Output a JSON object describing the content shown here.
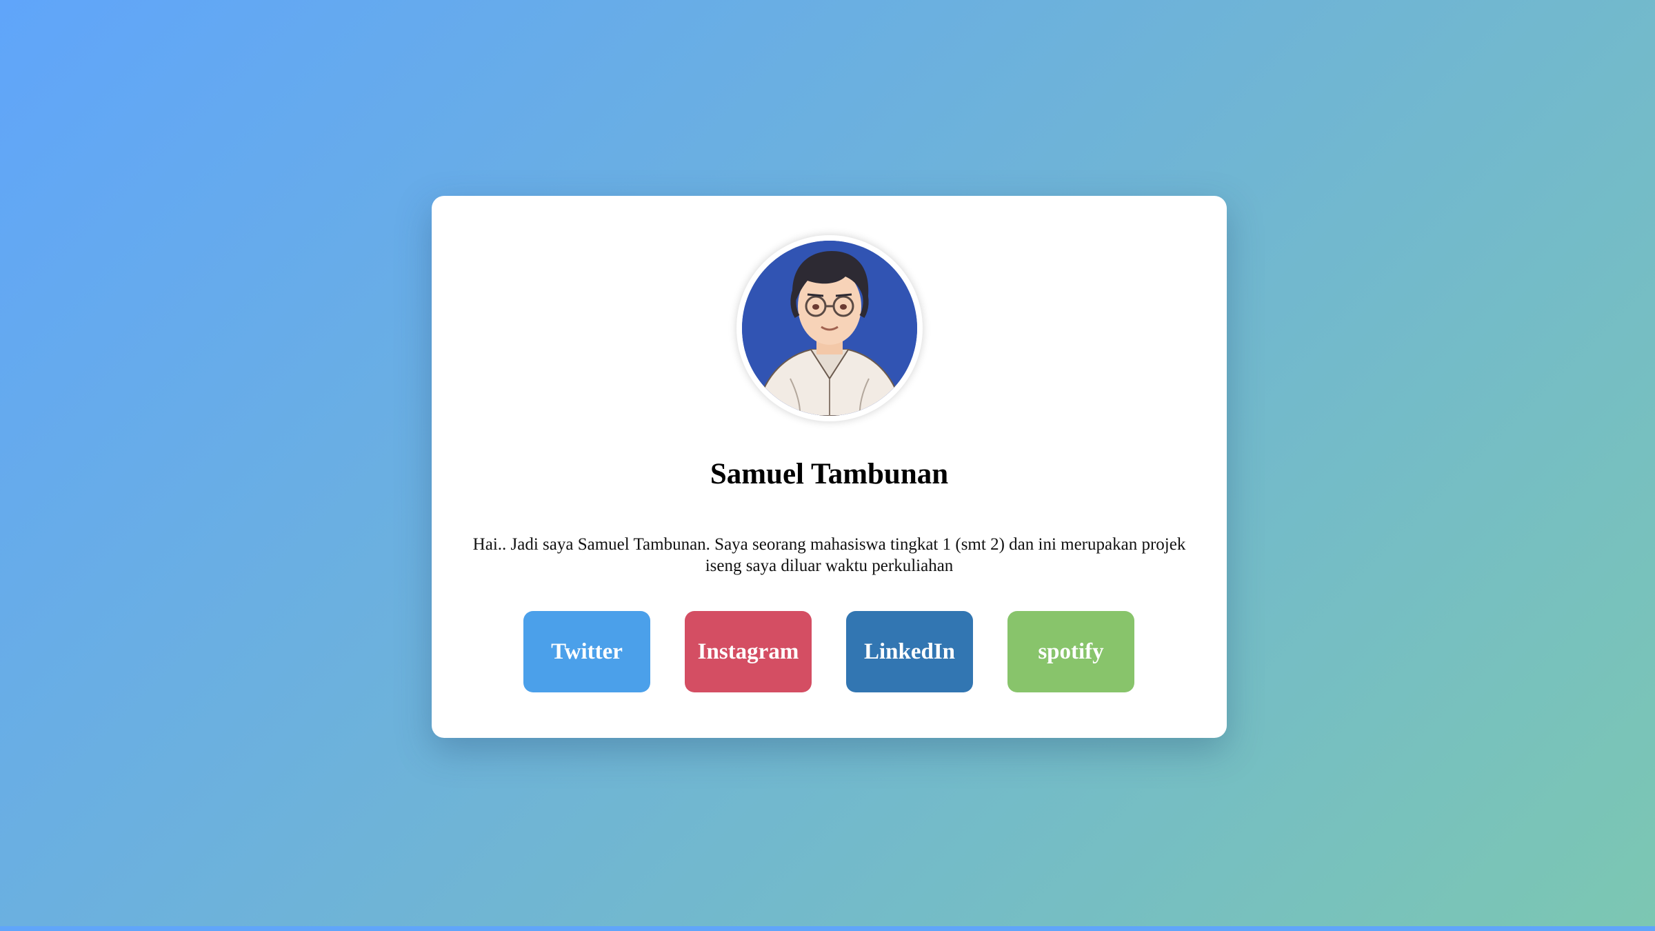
{
  "profile": {
    "name": "Samuel Tambunan",
    "bio": "Hai.. Jadi saya Samuel Tambunan. Saya seorang mahasiswa tingkat 1 (smt 2) dan ini merupakan projek iseng saya diluar waktu perkuliahan",
    "avatar_icon": "avatar-illustration"
  },
  "links": {
    "twitter": "Twitter",
    "instagram": "Instagram",
    "linkedin": "LinkedIn",
    "spotify": "spotify"
  },
  "colors": {
    "background_start": "#60a5fa",
    "background_end": "#7cc7b2",
    "twitter": "#4ba0ea",
    "instagram": "#d44e63",
    "linkedin": "#3276b2",
    "spotify": "#88c46b",
    "avatar_bg": "#3154b3"
  }
}
